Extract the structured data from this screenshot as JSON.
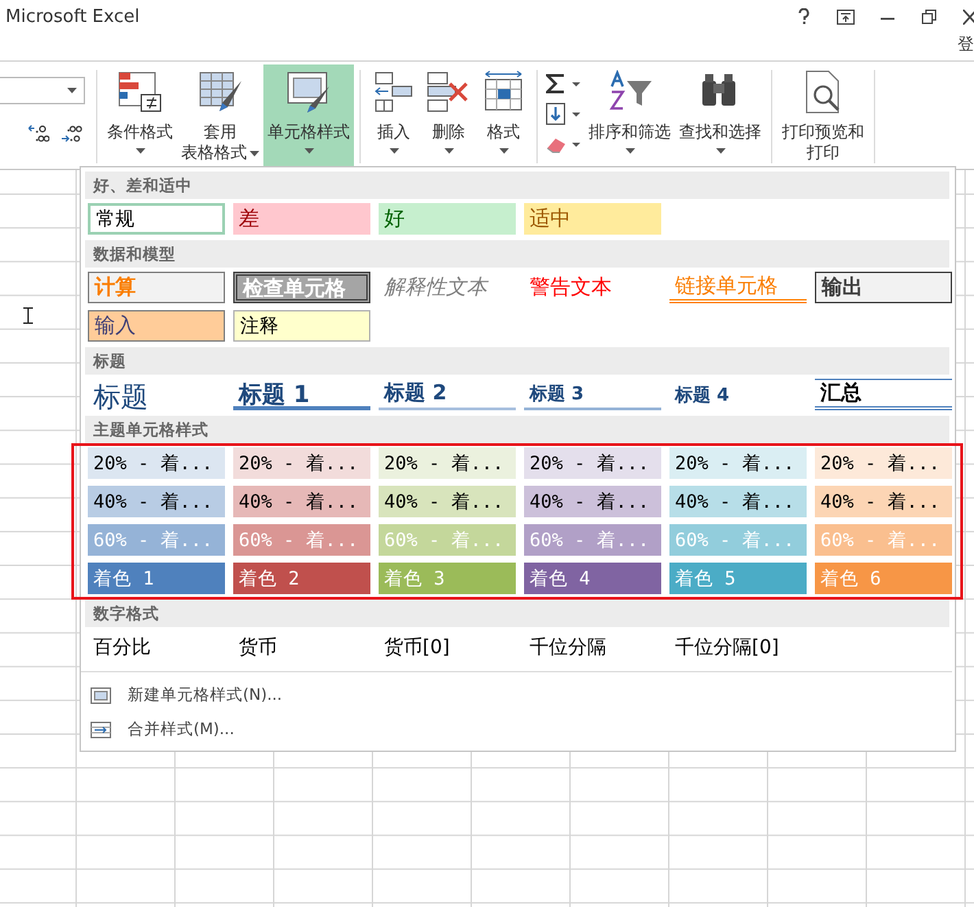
{
  "window": {
    "title": "Microsoft Excel",
    "account": "登"
  },
  "ribbon": {
    "buttons": [
      {
        "kind": "conditional",
        "lines": [
          "条件格式"
        ],
        "caret": true,
        "selected": false
      },
      {
        "kind": "table",
        "lines": [
          "套用",
          "表格格式"
        ],
        "caret": true,
        "selected": false
      },
      {
        "kind": "cellstyle",
        "lines": [
          "单元格样式"
        ],
        "caret": true,
        "selected": true
      },
      {
        "kind": "insert",
        "lines": [
          "插入"
        ],
        "caret": true,
        "selected": false
      },
      {
        "kind": "delete",
        "lines": [
          "删除"
        ],
        "caret": true,
        "selected": false
      },
      {
        "kind": "format",
        "lines": [
          "格式"
        ],
        "caret": true,
        "selected": false
      },
      {
        "kind": "editstack"
      },
      {
        "kind": "sort",
        "lines": [
          "排序和筛选"
        ],
        "caret": true,
        "selected": false
      },
      {
        "kind": "find",
        "lines": [
          "查找和选择"
        ],
        "caret": true,
        "selected": false
      },
      {
        "kind": "print",
        "lines": [
          "打印预览和",
          "打印"
        ],
        "caret": false,
        "selected": false
      }
    ]
  },
  "gallery": {
    "sections": [
      {
        "title": "好、差和适中",
        "rows": [
          [
            {
              "label": "常规",
              "kind": "normal"
            },
            {
              "label": "差",
              "kind": "bad"
            },
            {
              "label": "好",
              "kind": "good"
            },
            {
              "label": "适中",
              "kind": "neutral"
            }
          ]
        ]
      },
      {
        "title": "数据和模型",
        "rows": [
          [
            {
              "label": "计算",
              "kind": "calc"
            },
            {
              "label": "检查单元格",
              "kind": "check"
            },
            {
              "label": "解释性文本",
              "kind": "explan"
            },
            {
              "label": "警告文本",
              "kind": "warn"
            },
            {
              "label": "链接单元格",
              "kind": "linked"
            },
            {
              "label": "输出",
              "kind": "output"
            }
          ],
          [
            {
              "label": "输入",
              "kind": "input"
            },
            {
              "label": "注释",
              "kind": "note"
            }
          ]
        ]
      },
      {
        "title": "标题",
        "rows": [
          [
            {
              "label": "标题",
              "kind": "title"
            },
            {
              "label": "标题 1",
              "kind": "h1"
            },
            {
              "label": "标题 2",
              "kind": "h2"
            },
            {
              "label": "标题 3",
              "kind": "h3"
            },
            {
              "label": "标题 4",
              "kind": "h4"
            },
            {
              "label": "汇总",
              "kind": "total"
            }
          ]
        ]
      },
      {
        "title": "主题单元格样式",
        "rows": [
          [
            {
              "label": "20% - 着...",
              "kind": "tint",
              "color": "#dce6f1"
            },
            {
              "label": "20% - 着...",
              "kind": "tint",
              "color": "#f2dcdb"
            },
            {
              "label": "20% - 着...",
              "kind": "tint",
              "color": "#ebf1de"
            },
            {
              "label": "20% - 着...",
              "kind": "tint",
              "color": "#e4dfec"
            },
            {
              "label": "20% - 着...",
              "kind": "tint",
              "color": "#daeef3"
            },
            {
              "label": "20% - 着...",
              "kind": "tint",
              "color": "#fde9d9"
            }
          ],
          [
            {
              "label": "40% - 着...",
              "kind": "tint",
              "color": "#b8cce4"
            },
            {
              "label": "40% - 着...",
              "kind": "tint",
              "color": "#e6b8b7"
            },
            {
              "label": "40% - 着...",
              "kind": "tint",
              "color": "#d8e4bc"
            },
            {
              "label": "40% - 着...",
              "kind": "tint",
              "color": "#ccc0da"
            },
            {
              "label": "40% - 着...",
              "kind": "tint",
              "color": "#b7dee8"
            },
            {
              "label": "40% - 着...",
              "kind": "tint",
              "color": "#fcd5b4"
            }
          ],
          [
            {
              "label": "60% - 着...",
              "kind": "shade",
              "color": "#95b3d7"
            },
            {
              "label": "60% - 着...",
              "kind": "shade",
              "color": "#da9694"
            },
            {
              "label": "60% - 着...",
              "kind": "shade",
              "color": "#c4d79b"
            },
            {
              "label": "60% - 着...",
              "kind": "shade",
              "color": "#b1a0c7"
            },
            {
              "label": "60% - 着...",
              "kind": "shade",
              "color": "#92cddc"
            },
            {
              "label": "60% - 着...",
              "kind": "shade",
              "color": "#fabf8f"
            }
          ],
          [
            {
              "label": "着色 1",
              "kind": "shade",
              "color": "#4f81bd"
            },
            {
              "label": "着色 2",
              "kind": "shade",
              "color": "#c0504d"
            },
            {
              "label": "着色 3",
              "kind": "shade",
              "color": "#9bbb59"
            },
            {
              "label": "着色 4",
              "kind": "shade",
              "color": "#8064a2"
            },
            {
              "label": "着色 5",
              "kind": "shade",
              "color": "#4bacc6"
            },
            {
              "label": "着色 6",
              "kind": "shade",
              "color": "#f79646"
            }
          ]
        ],
        "highlighted": true
      },
      {
        "title": "数字格式",
        "rows": [
          [
            {
              "label": "百分比",
              "kind": "plain"
            },
            {
              "label": "货币",
              "kind": "plain"
            },
            {
              "label": "货币[0]",
              "kind": "plain"
            },
            {
              "label": "千位分隔",
              "kind": "plain"
            },
            {
              "label": "千位分隔[0]",
              "kind": "plain"
            }
          ]
        ]
      }
    ],
    "commands": [
      {
        "kind": "new",
        "label": "新建单元格样式(N)..."
      },
      {
        "kind": "merge",
        "label": "合并样式(M)..."
      }
    ]
  }
}
